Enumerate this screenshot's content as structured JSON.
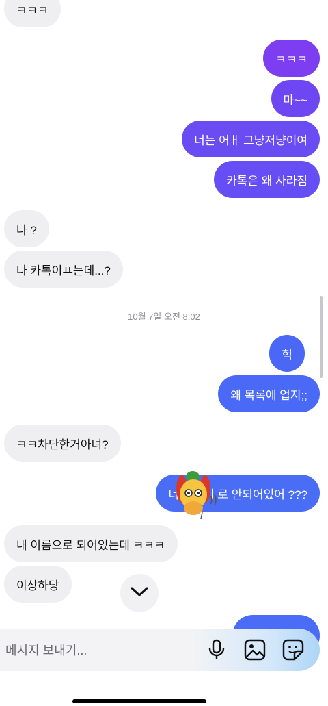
{
  "messages": [
    {
      "side": "in",
      "text": "ㅋㅋㅋ"
    },
    {
      "side": "out",
      "text": "ㅋㅋㅋ",
      "color": "#7d3df0"
    },
    {
      "side": "out",
      "text": "마~~",
      "color": "#6e47f2"
    },
    {
      "side": "out",
      "text": "너는 어ㅐ  그냥저냥이여",
      "color": "#6a4cf3"
    },
    {
      "side": "out",
      "text": "카톡은 왜 사라짐",
      "color": "#654ff4"
    },
    {
      "side": "in",
      "text": "나 ?"
    },
    {
      "side": "in",
      "text": "나 카톡이ㅛ는데...?"
    },
    {
      "side": "out",
      "text": "헉",
      "color": "#4b67f6"
    },
    {
      "side": "out",
      "text": "왜 목록에 업지;;",
      "color": "#4a69f6"
    },
    {
      "side": "in",
      "text": "ㅋㅋ차단한거아녀?"
    },
    {
      "side": "out",
      "text": "너 이름이               로 안되어있어 ???",
      "color": "#4a6df6"
    },
    {
      "side": "in",
      "text": "내 이름으로 되어있는데 ㅋㅋㅋ"
    },
    {
      "side": "in",
      "text": "이상하당"
    }
  ],
  "timestamp": "10월 7일 오전 8:02",
  "composer": {
    "placeholder": "메시지 보내기..."
  },
  "icons": {
    "mic": "microphone-icon",
    "gallery": "image-icon",
    "sticker": "sticker-icon",
    "scroll": "chevron-down-icon"
  },
  "colors": {
    "incoming_bg": "#efeff2",
    "accent_top": "#7d3df0",
    "accent_bottom": "#4a6cf7"
  }
}
